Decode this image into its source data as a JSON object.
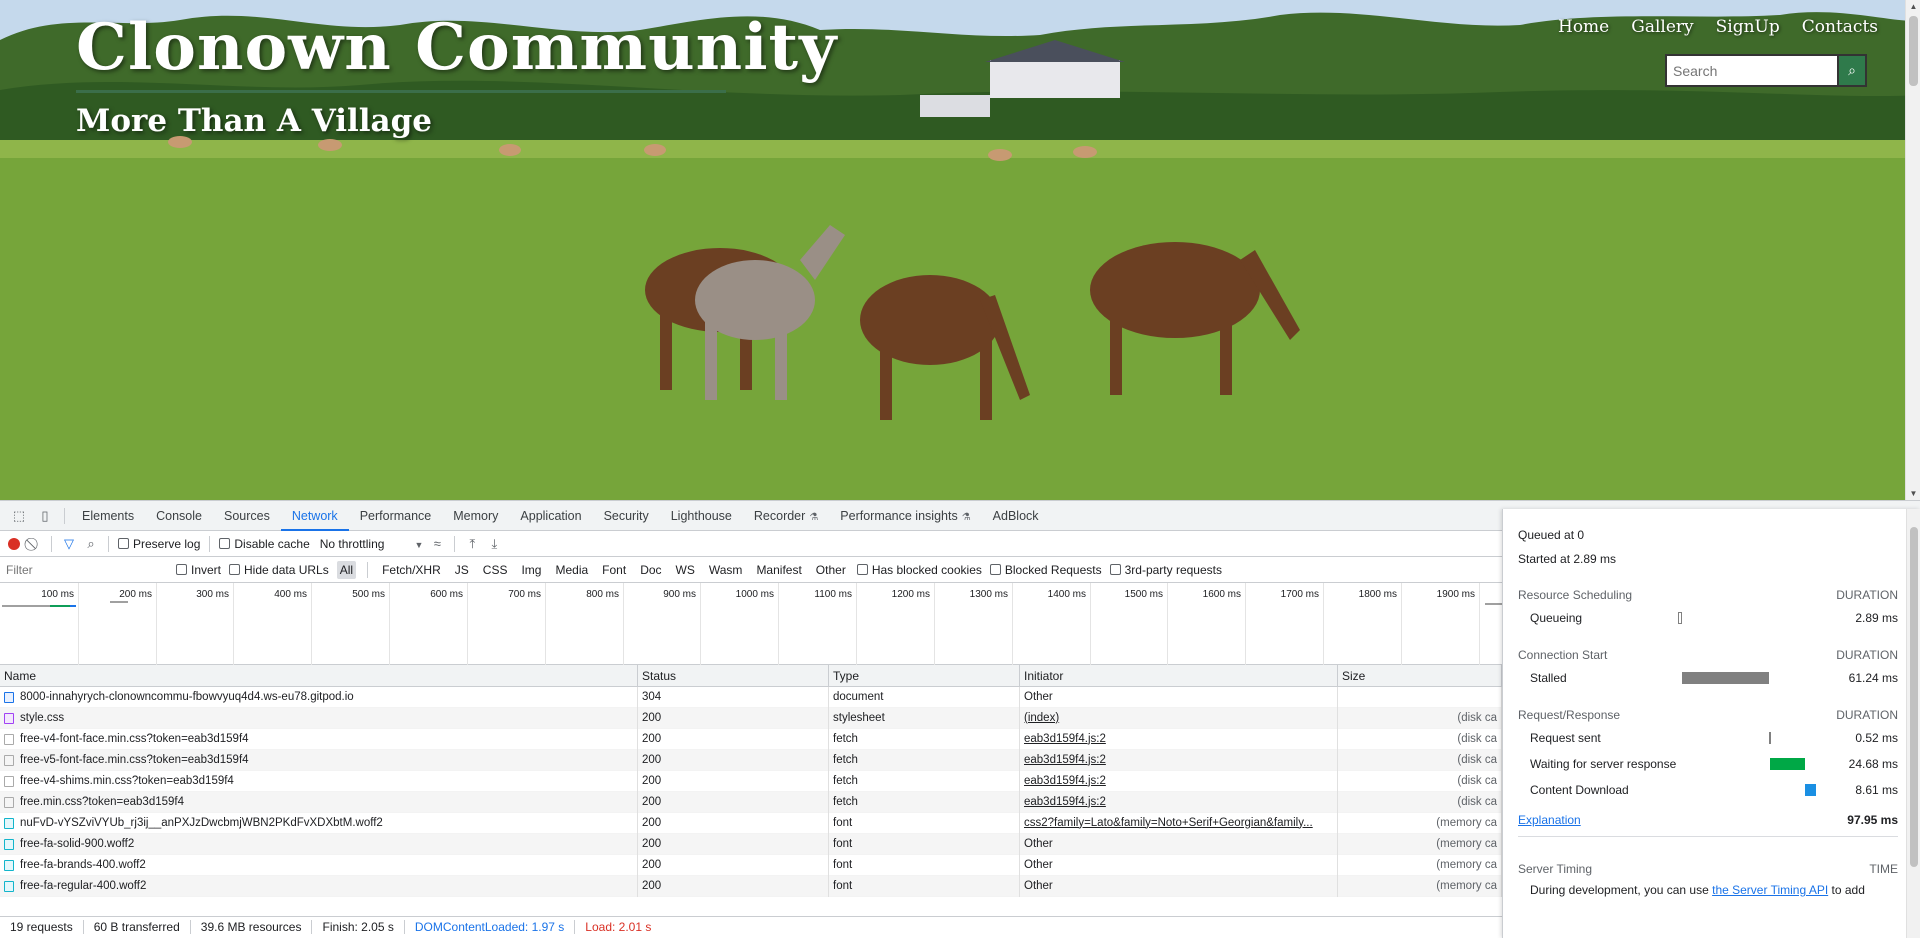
{
  "site": {
    "title": "Clonown Community",
    "subtitle": "More Than A Village",
    "nav": [
      "Home",
      "Gallery",
      "SignUp",
      "Contacts"
    ],
    "search_placeholder": "Search"
  },
  "devtools": {
    "tabs": [
      "Elements",
      "Console",
      "Sources",
      "Network",
      "Performance",
      "Memory",
      "Application",
      "Security",
      "Lighthouse",
      "Recorder",
      "Performance insights",
      "AdBlock"
    ],
    "active_tab": "Network",
    "toolbar": {
      "preserve_log": "Preserve log",
      "disable_cache": "Disable cache",
      "throttling": "No throttling"
    },
    "filter": {
      "placeholder": "Filter",
      "invert": "Invert",
      "hide_data_urls": "Hide data URLs",
      "types": [
        "All",
        "Fetch/XHR",
        "JS",
        "CSS",
        "Img",
        "Media",
        "Font",
        "Doc",
        "WS",
        "Wasm",
        "Manifest",
        "Other"
      ],
      "has_blocked_cookies": "Has blocked cookies",
      "blocked_requests": "Blocked Requests",
      "third_party": "3rd-party requests"
    },
    "overview_ticks": [
      "100 ms",
      "200 ms",
      "300 ms",
      "400 ms",
      "500 ms",
      "600 ms",
      "700 ms",
      "800 ms",
      "900 ms",
      "1000 ms",
      "1100 ms",
      "1200 ms",
      "1300 ms",
      "1400 ms",
      "1500 ms",
      "1600 ms",
      "1700 ms",
      "1800 ms",
      "1900 ms"
    ],
    "columns": [
      "Name",
      "Status",
      "Type",
      "Initiator",
      "Size"
    ],
    "rows": [
      {
        "name": "8000-innahyrych-clonowncommu-fbowvyuq4d4.ws-eu78.gitpod.io",
        "status": "304",
        "type": "document",
        "initiator": "Other",
        "size": "",
        "icon": "doc"
      },
      {
        "name": "style.css",
        "status": "200",
        "type": "stylesheet",
        "initiator": "(index)",
        "size": "(disk ca",
        "icon": "css"
      },
      {
        "name": "free-v4-font-face.min.css?token=eab3d159f4",
        "status": "200",
        "type": "fetch",
        "initiator": "eab3d159f4.js:2",
        "size": "(disk ca",
        "icon": "file"
      },
      {
        "name": "free-v5-font-face.min.css?token=eab3d159f4",
        "status": "200",
        "type": "fetch",
        "initiator": "eab3d159f4.js:2",
        "size": "(disk ca",
        "icon": "file"
      },
      {
        "name": "free-v4-shims.min.css?token=eab3d159f4",
        "status": "200",
        "type": "fetch",
        "initiator": "eab3d159f4.js:2",
        "size": "(disk ca",
        "icon": "file"
      },
      {
        "name": "free.min.css?token=eab3d159f4",
        "status": "200",
        "type": "fetch",
        "initiator": "eab3d159f4.js:2",
        "size": "(disk ca",
        "icon": "file"
      },
      {
        "name": "nuFvD-vYSZviVYUb_rj3ij__anPXJzDwcbmjWBN2PKdFvXDXbtM.woff2",
        "status": "200",
        "type": "font",
        "initiator": "css2?family=Lato&family=Noto+Serif+Georgian&family...",
        "size": "(memory ca",
        "icon": "font"
      },
      {
        "name": "free-fa-solid-900.woff2",
        "status": "200",
        "type": "font",
        "initiator": "Other",
        "size": "(memory ca",
        "icon": "font"
      },
      {
        "name": "free-fa-brands-400.woff2",
        "status": "200",
        "type": "font",
        "initiator": "Other",
        "size": "(memory ca",
        "icon": "font"
      },
      {
        "name": "free-fa-regular-400.woff2",
        "status": "200",
        "type": "font",
        "initiator": "Other",
        "size": "(memory ca",
        "icon": "font"
      }
    ],
    "status": {
      "requests": "19 requests",
      "transferred": "60 B transferred",
      "resources": "39.6 MB resources",
      "finish": "Finish: 2.05 s",
      "dom_content_loaded": "DOMContentLoaded: 1.97 s",
      "load": "Load: 2.01 s"
    },
    "timing": {
      "queued_at": "Queued at 0",
      "started_at": "Started at 2.89 ms",
      "duration_label": "DURATION",
      "sections": [
        {
          "title": "Resource Scheduling",
          "rows": [
            {
              "label": "Queueing",
              "value": "2.89 ms",
              "color": "#ffffff",
              "start": 0.0,
              "frac": 0.03
            }
          ]
        },
        {
          "title": "Connection Start",
          "rows": [
            {
              "label": "Stalled",
              "value": "61.24 ms",
              "color": "#808080",
              "start": 0.03,
              "frac": 0.63
            }
          ]
        },
        {
          "title": "Request/Response",
          "rows": [
            {
              "label": "Request sent",
              "value": "0.52 ms",
              "color": "#808080",
              "start": 0.66,
              "frac": 0.01
            },
            {
              "label": "Waiting for server response",
              "value": "24.68 ms",
              "color": "#00a846",
              "start": 0.67,
              "frac": 0.25
            },
            {
              "label": "Content Download",
              "value": "8.61 ms",
              "color": "#1a8fe3",
              "start": 0.92,
              "frac": 0.08
            }
          ]
        }
      ],
      "explanation": "Explanation",
      "total": "97.95 ms",
      "server_timing": "Server Timing",
      "time_label": "TIME",
      "server_text_prefix": "During development, you can use ",
      "server_link": "the Server Timing API",
      "server_text_suffix": " to add"
    }
  }
}
